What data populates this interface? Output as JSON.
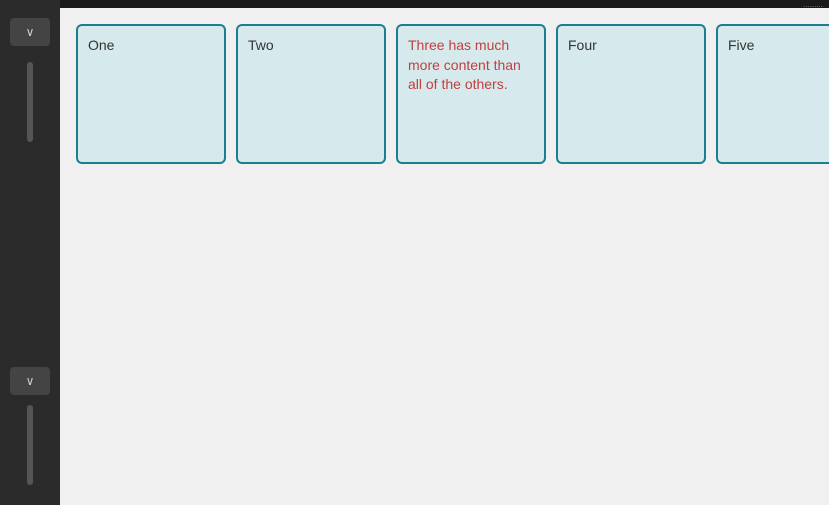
{
  "sidebar": {
    "top_button_label": "∨",
    "bottom_button_label": "∨"
  },
  "cards": [
    {
      "id": "one",
      "text": "One"
    },
    {
      "id": "two",
      "text": "Two"
    },
    {
      "id": "three",
      "text": "Three has much more content than all of the others.",
      "special": true
    },
    {
      "id": "four",
      "text": "Four"
    },
    {
      "id": "five",
      "text": "Five"
    }
  ],
  "top_bar": {
    "label": "........."
  },
  "more_indicator": "..."
}
